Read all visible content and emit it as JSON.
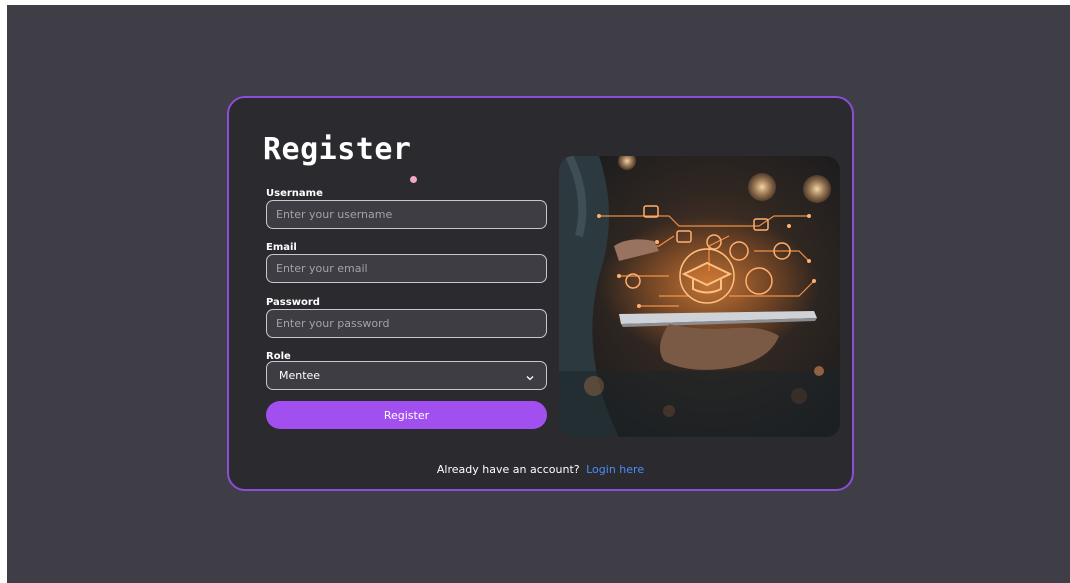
{
  "form": {
    "title": "Register",
    "fields": [
      {
        "label": "Username",
        "placeholder": "Enter your username",
        "value": ""
      },
      {
        "label": "Email",
        "placeholder": "Enter your email",
        "value": ""
      },
      {
        "label": "Password",
        "placeholder": "Enter your password",
        "value": ""
      }
    ],
    "role": {
      "label": "Role",
      "selected": "Mentee"
    },
    "submit_label": "Register"
  },
  "footer": {
    "prompt": "Already have an account?",
    "link_label": "Login here"
  },
  "image": {
    "icon": "education-technology-illustration"
  },
  "colors": {
    "page_bg": "#3f3e47",
    "card_bg": "#2b2a2f",
    "card_border": "#8a4fd6",
    "button": "#a24ff0",
    "link": "#4a8cf7"
  }
}
